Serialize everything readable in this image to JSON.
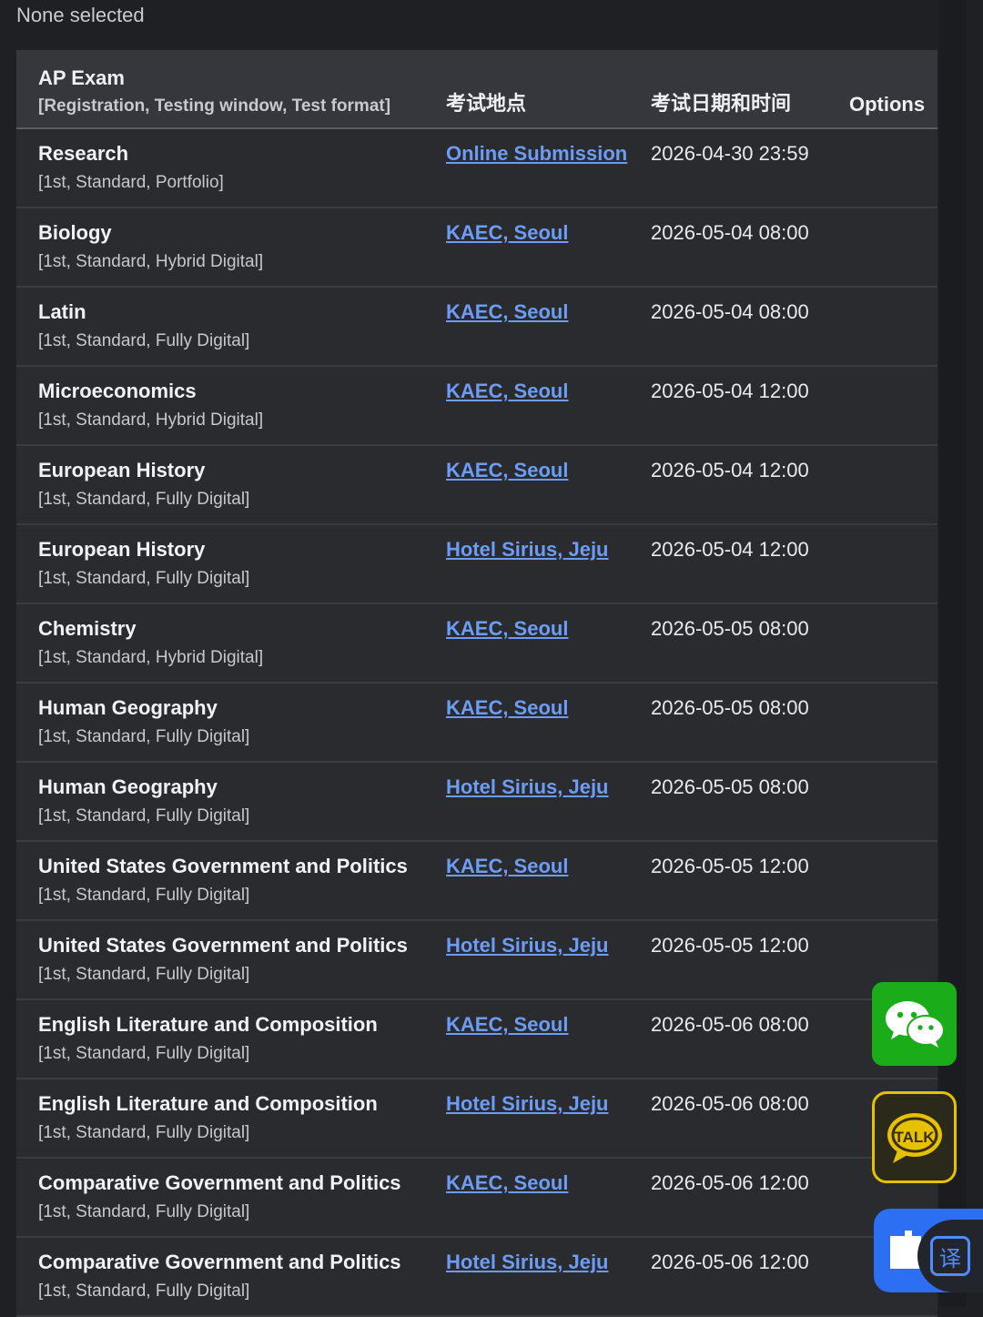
{
  "selection_status": "None selected",
  "table": {
    "headers": {
      "exam": "AP Exam",
      "exam_sub": "[Registration, Testing window, Test format]",
      "location": "考试地点",
      "datetime": "考试日期和时间",
      "options": "Options"
    },
    "rows": [
      {
        "subject": "Research",
        "details": "[1st, Standard, Portfolio]",
        "location": "Online Submission",
        "datetime": "2026-04-30 23:59"
      },
      {
        "subject": "Biology",
        "details": "[1st, Standard, Hybrid Digital]",
        "location": "KAEC, Seoul",
        "datetime": "2026-05-04 08:00"
      },
      {
        "subject": "Latin",
        "details": "[1st, Standard, Fully Digital]",
        "location": "KAEC, Seoul",
        "datetime": "2026-05-04 08:00"
      },
      {
        "subject": "Microeconomics",
        "details": "[1st, Standard, Hybrid Digital]",
        "location": "KAEC, Seoul",
        "datetime": "2026-05-04 12:00"
      },
      {
        "subject": "European History",
        "details": "[1st, Standard, Fully Digital]",
        "location": "KAEC, Seoul",
        "datetime": "2026-05-04 12:00"
      },
      {
        "subject": "European History",
        "details": "[1st, Standard, Fully Digital]",
        "location": "Hotel Sirius, Jeju",
        "datetime": "2026-05-04 12:00"
      },
      {
        "subject": "Chemistry",
        "details": "[1st, Standard, Hybrid Digital]",
        "location": "KAEC, Seoul",
        "datetime": "2026-05-05 08:00"
      },
      {
        "subject": "Human Geography",
        "details": "[1st, Standard, Fully Digital]",
        "location": "KAEC, Seoul",
        "datetime": "2026-05-05 08:00"
      },
      {
        "subject": "Human Geography",
        "details": "[1st, Standard, Fully Digital]",
        "location": "Hotel Sirius, Jeju",
        "datetime": "2026-05-05 08:00"
      },
      {
        "subject": "United States Government and Politics",
        "details": "[1st, Standard, Fully Digital]",
        "location": "KAEC, Seoul",
        "datetime": "2026-05-05 12:00"
      },
      {
        "subject": "United States Government and Politics",
        "details": "[1st, Standard, Fully Digital]",
        "location": "Hotel Sirius, Jeju",
        "datetime": "2026-05-05 12:00"
      },
      {
        "subject": "English Literature and Composition",
        "details": "[1st, Standard, Fully Digital]",
        "location": "KAEC, Seoul",
        "datetime": "2026-05-06 08:00"
      },
      {
        "subject": "English Literature and Composition",
        "details": "[1st, Standard, Fully Digital]",
        "location": "Hotel Sirius, Jeju",
        "datetime": "2026-05-06 08:00"
      },
      {
        "subject": "Comparative Government and Politics",
        "details": "[1st, Standard, Fully Digital]",
        "location": "KAEC, Seoul",
        "datetime": "2026-05-06 12:00"
      },
      {
        "subject": "Comparative Government and Politics",
        "details": "[1st, Standard, Fully Digital]",
        "location": "Hotel Sirius, Jeju",
        "datetime": "2026-05-06 12:00"
      }
    ]
  },
  "floating_buttons": {
    "wechat_icon": "wechat-icon",
    "kakao_icon": "kakaotalk-icon",
    "kakao_text": "TALK",
    "translate_icon": "translate-icon",
    "translate_glyph": "译"
  },
  "colors": {
    "link": "#6d9cf5",
    "wechat": "#1aad19",
    "kakao": "#e5c100",
    "translate": "#2d6ff2"
  }
}
